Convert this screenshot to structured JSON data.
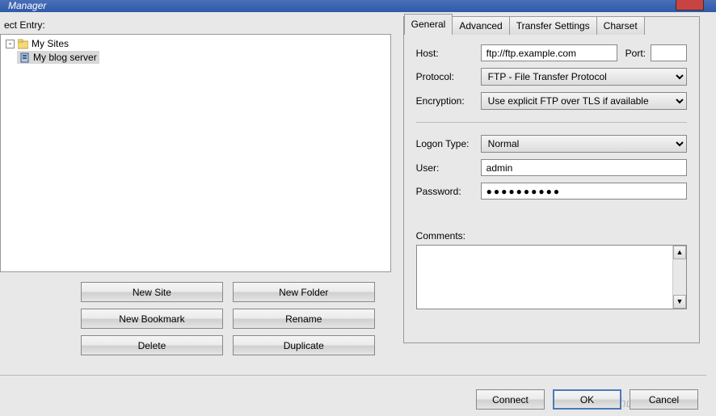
{
  "window": {
    "title_fragment": "Manager"
  },
  "left": {
    "section_label": "ect Entry:",
    "tree_root": "My Sites",
    "tree_child": "My blog server"
  },
  "buttons": {
    "new_site": "New Site",
    "new_folder": "New Folder",
    "new_bookmark": "New Bookmark",
    "rename": "Rename",
    "delete": "Delete",
    "duplicate": "Duplicate"
  },
  "tabs": {
    "general": "General",
    "advanced": "Advanced",
    "transfer": "Transfer Settings",
    "charset": "Charset"
  },
  "form": {
    "host_label": "Host:",
    "host_value": "ftp://ftp.example.com",
    "port_label": "Port:",
    "port_value": "",
    "protocol_label": "Protocol:",
    "protocol_value": "FTP - File Transfer Protocol",
    "encryption_label": "Encryption:",
    "encryption_value": "Use explicit FTP over TLS if available",
    "logon_label": "Logon Type:",
    "logon_value": "Normal",
    "user_label": "User:",
    "user_value": "admin",
    "password_label": "Password:",
    "password_value": "●●●●●●●●●●",
    "comments_label": "Comments:",
    "comments_value": ""
  },
  "footer": {
    "connect": "Connect",
    "ok": "OK",
    "cancel": "Cancel"
  },
  "watermark": "智汇zhuon.com"
}
